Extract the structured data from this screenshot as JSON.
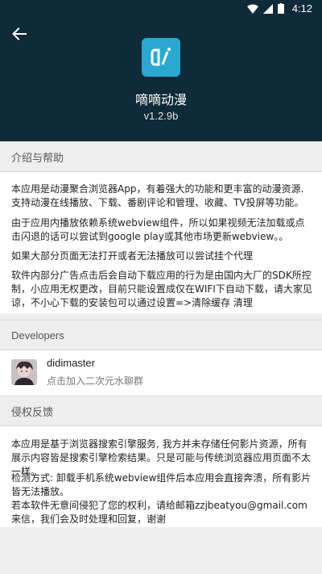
{
  "status_bar": {
    "time": "4:12",
    "icons": [
      "wifi-icon",
      "signal-icon",
      "battery-icon"
    ]
  },
  "header": {
    "app_name": "嘀嘀动漫",
    "version": "v1.2.9b",
    "background": "#0f2a38",
    "icon_color": "#2aa8d2"
  },
  "sections": {
    "intro": {
      "title": "介绍与帮助",
      "paragraphs": [
        "本应用是动漫聚合浏览器App，有着强大的功能和更丰富的动漫资源. 支持动漫在线播放、下载、番剧评论和管理、收藏、TV投屏等功能。",
        "由于应用内播放依赖系统webview组件，所以如果视频无法加载或点击闪退的话可以尝试到google play或其他市场更新webview。。",
        "如果大部分页面无法打开或者无法播放可以尝试挂个代理",
        "软件内部分广告点击后会自动下载应用的行为是由国内大厂的SDK所控制，小应用无权更改，目前只能设置成仅在WIFI下自动下载，请大家见谅，不小心下载的安装包可以通过设置=>清除缓存 清理"
      ]
    },
    "developers": {
      "title": "Developers",
      "name": "didimaster",
      "subtitle": "点击加入二次元水聊群"
    },
    "infringement": {
      "title": "侵权反馈",
      "paragraphs": [
        "本应用是基于浏览器搜索引擎服务, 我方并未存储任何影片资源，所有展示内容皆是搜索引擎检索结果。只是可能与传统浏览器应用页面不太一样。",
        "检测方式: 卸载手机系统webview组件后本应用会直接奔溃，所有影片皆无法播放。",
        "若本软件无意间侵犯了您的权利，请给邮箱zzjbeatyou@gmail.com来信，我们会及时处理和回复，谢谢"
      ]
    }
  }
}
